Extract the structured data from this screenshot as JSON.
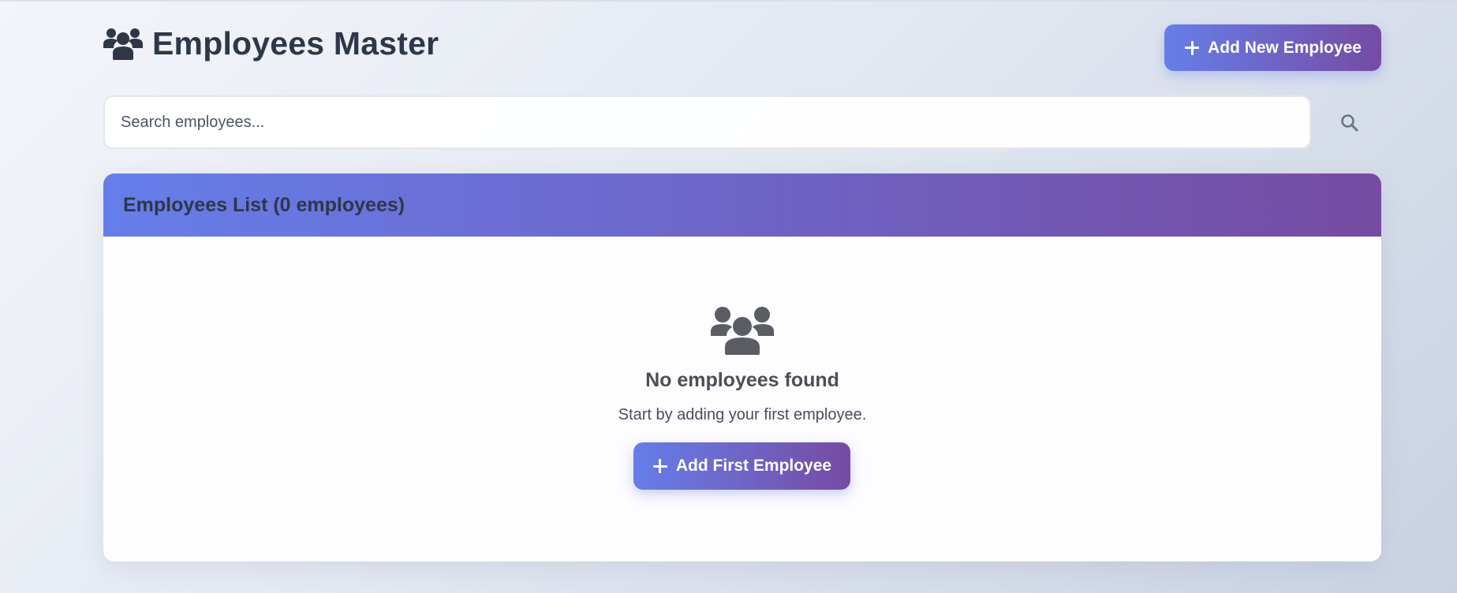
{
  "header": {
    "title": "Employees Master",
    "add_button_label": "Add New Employee"
  },
  "search": {
    "placeholder": "Search employees..."
  },
  "list": {
    "title": "Employees List (0 employees)",
    "employee_count": 0
  },
  "empty_state": {
    "title": "No employees found",
    "subtitle": "Start by adding your first employee.",
    "button_label": "Add First Employee"
  },
  "icons": {
    "title": "users-icon",
    "add": "plus-icon",
    "search": "search-icon",
    "empty": "users-icon"
  },
  "colors": {
    "accent_start": "#667eea",
    "accent_end": "#764ba2",
    "text_dark": "#2d3748",
    "text_muted": "#4a4f57",
    "icon_gray": "#5a5d63"
  }
}
